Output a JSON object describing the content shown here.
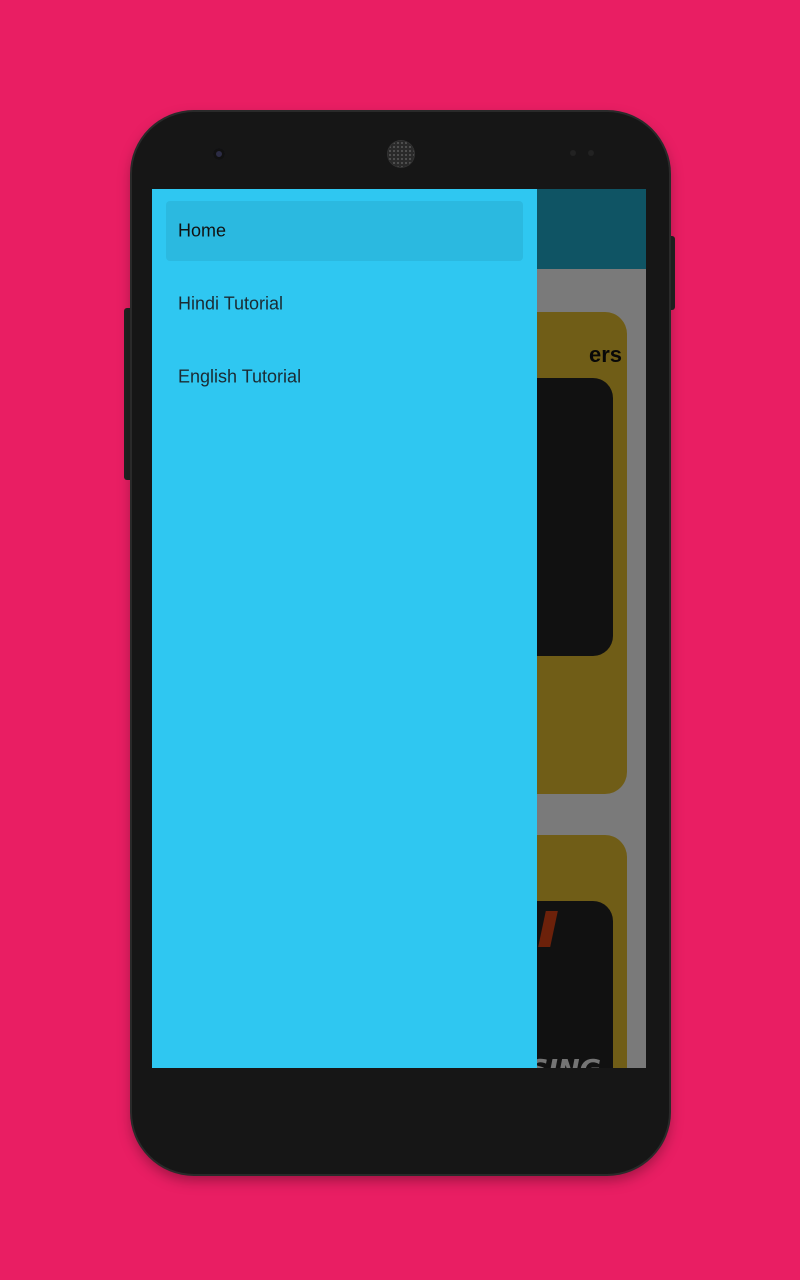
{
  "colors": {
    "background": "#E91E63",
    "drawer": "#2FC7F1",
    "app_bar": "#1FA9C9",
    "card": "#E1BB2E"
  },
  "drawer": {
    "items": [
      {
        "label": "Home",
        "selected": true
      },
      {
        "label": "Hindi Tutorial",
        "selected": false
      },
      {
        "label": "English Tutorial",
        "selected": false
      }
    ]
  },
  "content": {
    "cards": [
      {
        "title_visible": "ers"
      },
      {
        "image_text_visible": "USING"
      }
    ]
  }
}
